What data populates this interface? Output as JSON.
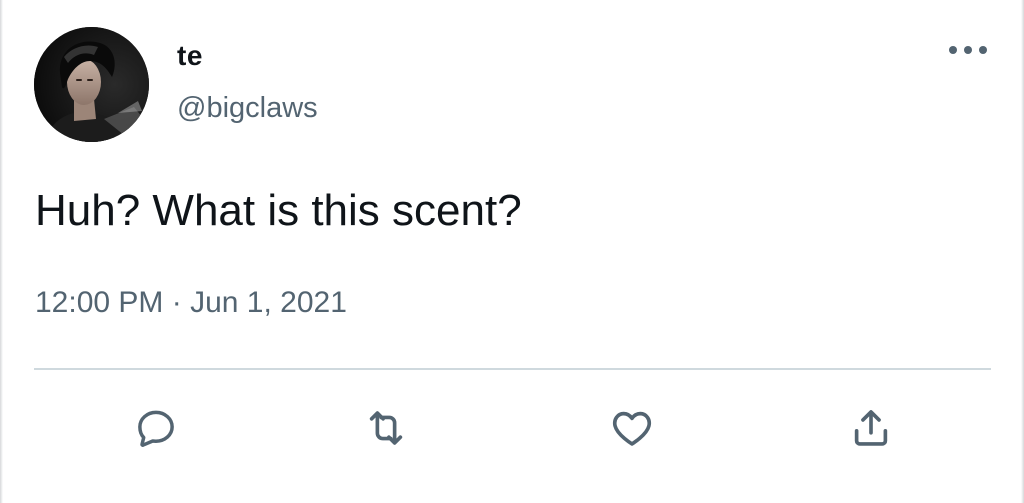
{
  "user": {
    "display_name": "te",
    "handle": "@bigclaws",
    "avatar": "profile-photo"
  },
  "tweet": {
    "text": "Huh? What is this scent?",
    "time": "12:00 PM",
    "separator": " · ",
    "date": "Jun 1, 2021"
  },
  "icons": {
    "more": "more-horizontal-icon",
    "reply": "reply-icon",
    "retweet": "retweet-icon",
    "like": "heart-icon",
    "share": "share-icon"
  },
  "colors": {
    "text_primary": "#0f1419",
    "text_secondary": "#536471",
    "divider": "#cfd9de",
    "icon": "#536471"
  }
}
